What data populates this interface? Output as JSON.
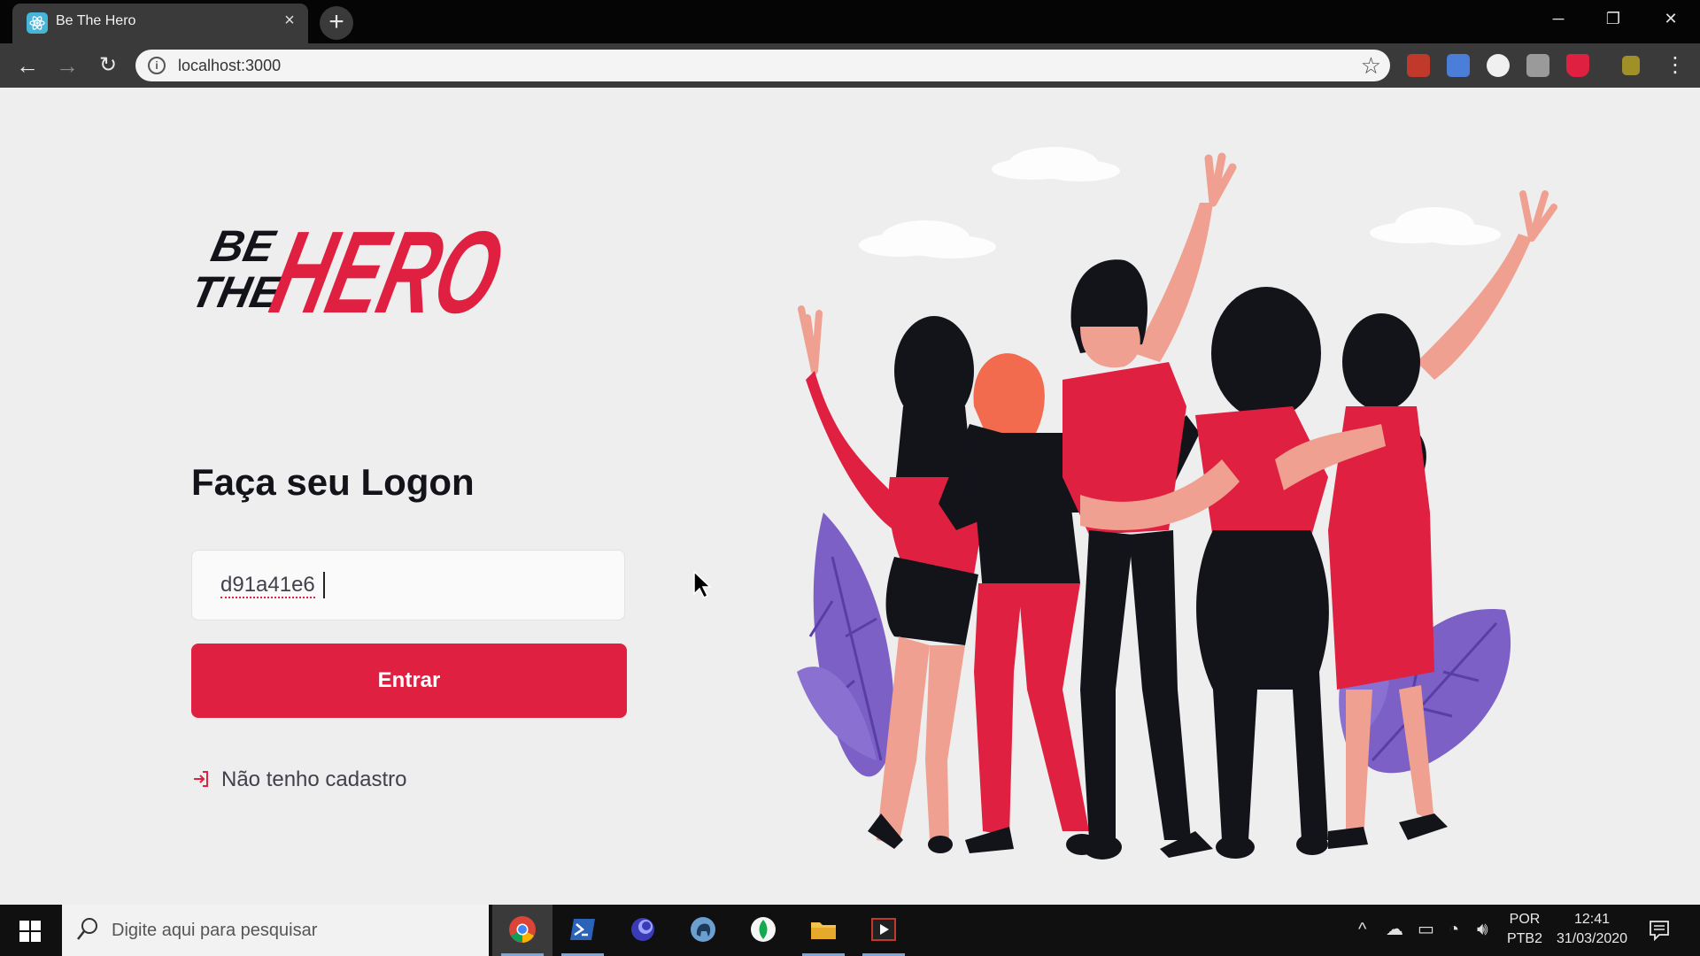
{
  "browser": {
    "tab_title": "Be The Hero",
    "tab_close": "×",
    "new_tab": "+",
    "url": "localhost:3000",
    "window_controls": {
      "minimize": "─",
      "restore": "❐",
      "close": "✕"
    }
  },
  "page": {
    "logo_text_top": "BE",
    "logo_text_mid": "THE",
    "logo_text_main": "HERO",
    "heading": "Faça seu Logon",
    "id_input_value": "d91a41e6",
    "submit_label": "Entrar",
    "register_link": "Não tenho cadastro",
    "brand_color": "#e02041"
  },
  "taskbar": {
    "search_placeholder": "Digite aqui para pesquisar",
    "language_line1": "POR",
    "language_line2": "PTB2",
    "time": "12:41",
    "date": "31/03/2020",
    "apps": [
      "chrome-icon",
      "powershell-icon",
      "browser-icon",
      "elephant-icon",
      "mongodb-icon",
      "file-explorer-icon",
      "media-player-icon"
    ]
  }
}
